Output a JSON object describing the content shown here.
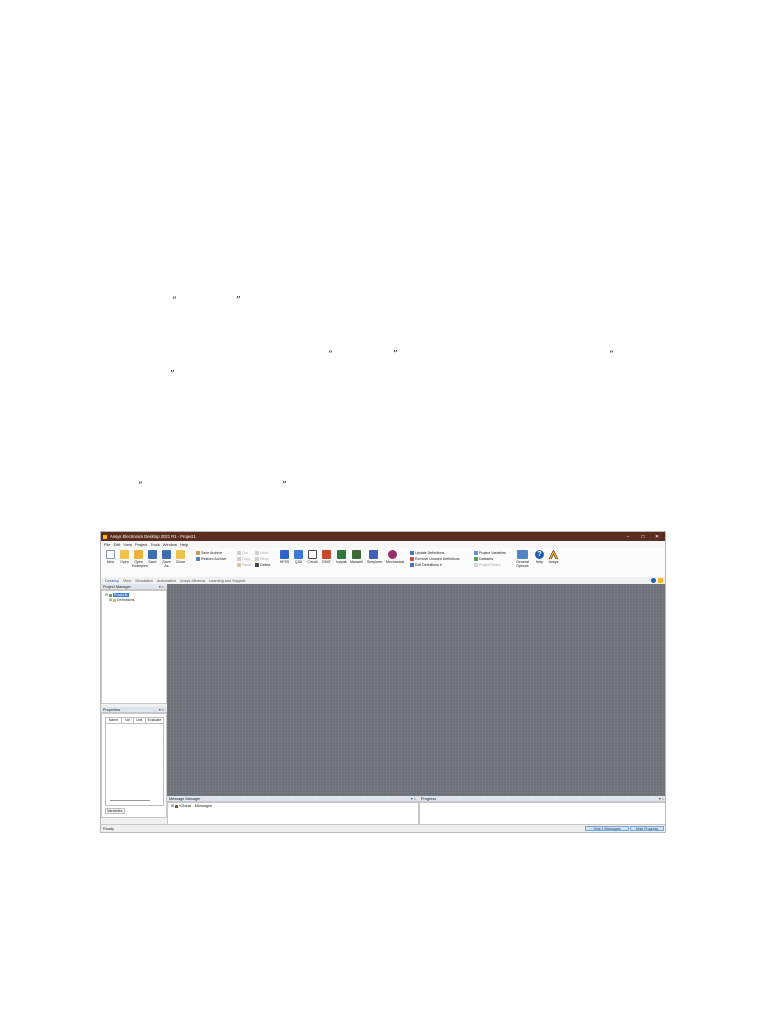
{
  "quotes": {
    "open": "“",
    "close": "”"
  },
  "app": {
    "title": "Ansys Electronics Desktop 2021 R1 - Project1",
    "window_controls": [
      "–",
      "□",
      "✕"
    ],
    "menu": [
      "File",
      "Edit",
      "View",
      "Project",
      "Tools",
      "Window",
      "Help"
    ],
    "ribbon": {
      "large_buttons": [
        {
          "label": "New",
          "icon": "new-file-icon",
          "color": "#ffffff"
        },
        {
          "label": "Open",
          "icon": "open-folder-icon",
          "color": "#f0c24b"
        },
        {
          "label": "Open Examples",
          "icon": "examples-folder-icon",
          "color": "#f0b03a"
        },
        {
          "label": "Save",
          "icon": "save-icon",
          "color": "#3e6fb5"
        },
        {
          "label": "Save As",
          "icon": "save-as-icon",
          "color": "#3e6fb5"
        },
        {
          "label": "Close",
          "icon": "close-folder-icon",
          "color": "#f0c24b"
        }
      ],
      "archive": [
        "Save Archive",
        "Restore Archive"
      ],
      "edit_group": [
        "Cut",
        "Undo",
        "Copy",
        "Redo",
        "Paste",
        "Delete"
      ],
      "design_buttons": [
        {
          "label": "HFSS",
          "icon": "hfss-icon",
          "color": "#2e64c9"
        },
        {
          "label": "Q3D",
          "icon": "q3d-icon",
          "color": "#3b7ad9"
        },
        {
          "label": "Circuit",
          "icon": "circuit-icon",
          "color": "#4a4a4a"
        },
        {
          "label": "EMIT",
          "icon": "emit-icon",
          "color": "#c74a2a"
        },
        {
          "label": "Icepak",
          "icon": "icepak-icon",
          "color": "#2d7a3c"
        },
        {
          "label": "Maxwell",
          "icon": "maxwell-icon",
          "color": "#3a6b35"
        },
        {
          "label": "Simplorer",
          "icon": "simplorer-icon",
          "color": "#3d62b8"
        },
        {
          "label": "Mechanical",
          "icon": "mechanical-icon",
          "color": "#9b2d6b"
        }
      ],
      "definitions": [
        "Update Definitions",
        "Remove Unused Definitions",
        "Edit Definitions"
      ],
      "project": [
        "Project Variables",
        "Datasets",
        "Project Notes"
      ],
      "right_buttons": [
        {
          "label": "General Options",
          "icon": "general-options-icon",
          "color": "#4f86c6"
        },
        {
          "label": "Help",
          "icon": "help-icon",
          "color": "#1f5fb8"
        },
        {
          "label": "Ansys",
          "icon": "ansys-logo-icon",
          "color": "#ffb71b"
        }
      ]
    },
    "ribbon_tabs": [
      "Desktop",
      "View",
      "Simulation",
      "Automation",
      "Ansys Minerva",
      "Learning and Support"
    ],
    "project_manager": {
      "title": "Project Manager",
      "tree": [
        "Project1",
        "Definitions"
      ]
    },
    "properties": {
      "title": "Properties",
      "columns": [
        "Name",
        "Val",
        "Unit",
        "Evaluate"
      ],
      "tab": "Variables"
    },
    "message_manager": {
      "title": "Message Manager",
      "item": "*Global - Messages"
    },
    "progress": {
      "title": "Progress"
    },
    "status": {
      "text": "Ready",
      "hide_messages": "Hide 1 Messages",
      "hide_progress": "Hide Progress"
    },
    "colors": {
      "titlebar": "#5b2d1e",
      "canvas": "#6e7178",
      "selection": "#3a7bd5"
    }
  }
}
